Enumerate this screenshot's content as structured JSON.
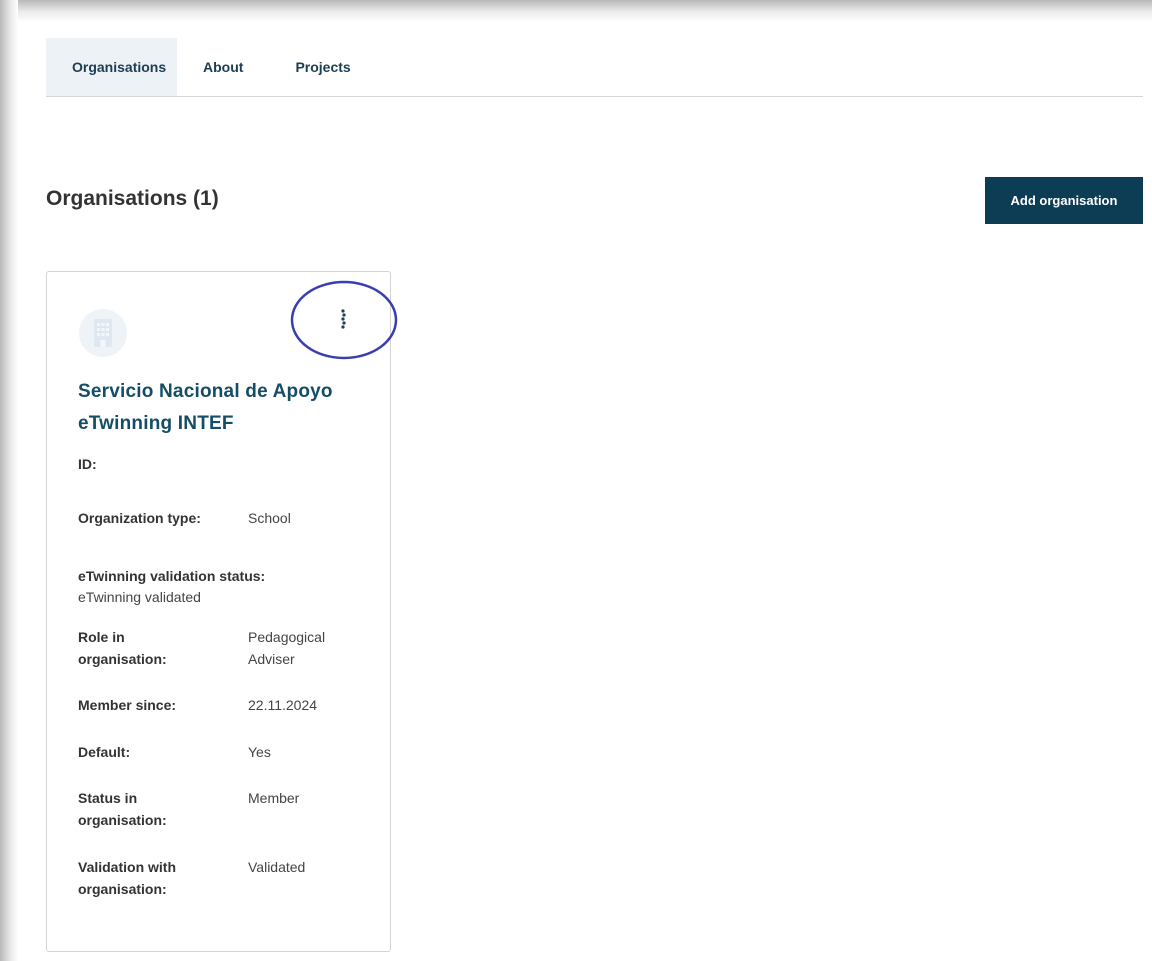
{
  "tabs": [
    {
      "label": "Organisations",
      "active": true
    },
    {
      "label": "About",
      "active": false
    },
    {
      "label": "Projects",
      "active": false
    }
  ],
  "page": {
    "title": "Organisations (1)",
    "add_button_label": "Add organisation"
  },
  "colors": {
    "primary": "#0d3d55",
    "title_link": "#154d66",
    "active_tab_bg": "#edf2f6",
    "highlight_circle": "#3b3fae"
  },
  "card": {
    "icon": "building-icon",
    "menu_icon": "kebab-menu-icon",
    "name": "Servicio Nacional de Apoyo eTwinning INTEF",
    "fields": {
      "id": {
        "label": "ID:",
        "value": ""
      },
      "org_type": {
        "label": "Organization type:",
        "value": "School"
      },
      "validation_status": {
        "label": "eTwinning validation status:",
        "value": "eTwinning validated"
      },
      "role": {
        "label": "Role in organisation:",
        "value": "Pedagogical Adviser"
      },
      "member_since": {
        "label": "Member since:",
        "value": "22.11.2024"
      },
      "default": {
        "label": "Default:",
        "value": "Yes"
      },
      "status": {
        "label": "Status in organisation:",
        "value": "Member"
      },
      "validation_with_org": {
        "label": "Validation with organisation:",
        "value": "Validated"
      }
    }
  }
}
